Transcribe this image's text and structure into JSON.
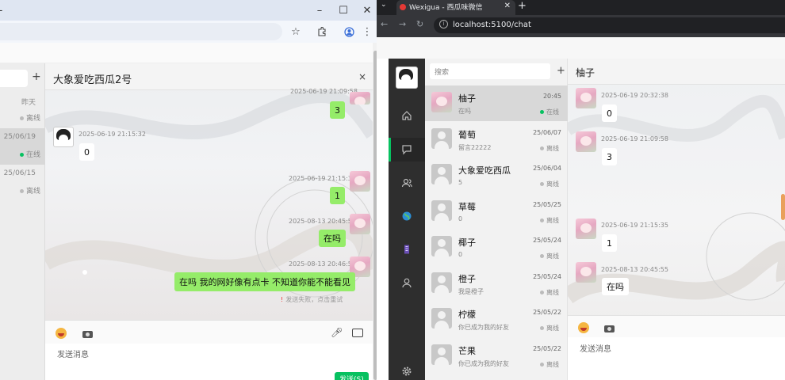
{
  "left_window": {
    "controls": {
      "minimize": "–",
      "maximize": "☐",
      "close": "✕"
    },
    "list_items": [
      {
        "date": "昨天",
        "status": "离线",
        "online": false
      },
      {
        "date": "25/06/19",
        "status": "在线",
        "online": true
      },
      {
        "date": "25/06/15",
        "status": "离线",
        "online": false
      }
    ],
    "chat": {
      "title": "大象爱吃西瓜2号",
      "close": "×",
      "messages": [
        {
          "time": "2025-06-19 21:09:58",
          "text": "3",
          "mine": true
        },
        {
          "time": "2025-06-19 21:15:32",
          "text": "0",
          "mine": false
        },
        {
          "time": "2025-06-19 21:15:35",
          "text": "1",
          "mine": true
        },
        {
          "time": "2025-08-13 20:45:55",
          "text": "在吗",
          "mine": true
        },
        {
          "time": "2025-08-13 20:46:51",
          "text": "在吗 我的网好像有点卡 不知道你能不能看见",
          "mine": true
        }
      ],
      "fail_text": "发送失败，点击重试",
      "input_placeholder": "发送消息",
      "send_label": "发送(S)"
    }
  },
  "right_window": {
    "tab_title": "Wexigua - 西瓜味微信",
    "url": "localhost:5100/chat",
    "search_placeholder": "搜索",
    "contacts": [
      {
        "name": "柚子",
        "msg": "在吗",
        "date": "20:45",
        "status": "在线",
        "online": true
      },
      {
        "name": "葡萄",
        "msg": "留言22222",
        "date": "25/06/07",
        "status": "离线",
        "online": false
      },
      {
        "name": "大象爱吃西瓜",
        "msg": "5",
        "date": "25/06/04",
        "status": "离线",
        "online": false
      },
      {
        "name": "草莓",
        "msg": "0",
        "date": "25/05/25",
        "status": "离线",
        "online": false
      },
      {
        "name": "椰子",
        "msg": "0",
        "date": "25/05/24",
        "status": "离线",
        "online": false
      },
      {
        "name": "橙子",
        "msg": "我是橙子",
        "date": "25/05/24",
        "status": "离线",
        "online": false
      },
      {
        "name": "柠檬",
        "msg": "你已成为我的好友",
        "date": "25/05/22",
        "status": "离线",
        "online": false
      },
      {
        "name": "芒果",
        "msg": "你已成为我的好友",
        "date": "25/05/22",
        "status": "离线",
        "online": false
      }
    ],
    "chat": {
      "title": "柚子",
      "messages": [
        {
          "time": "2025-06-19 20:32:38",
          "text": "0"
        },
        {
          "time": "2025-06-19 21:09:58",
          "text": "3"
        },
        {
          "time": "2025-06-19 21:15:35",
          "text": "1"
        },
        {
          "time": "2025-08-13 20:45:55",
          "text": "在吗"
        }
      ],
      "input_placeholder": "发送消息"
    }
  },
  "colors": {
    "accent": "#07c160",
    "bubble_mine": "#95ec69",
    "online": "#07c160",
    "offline": "#bbbbbb"
  }
}
